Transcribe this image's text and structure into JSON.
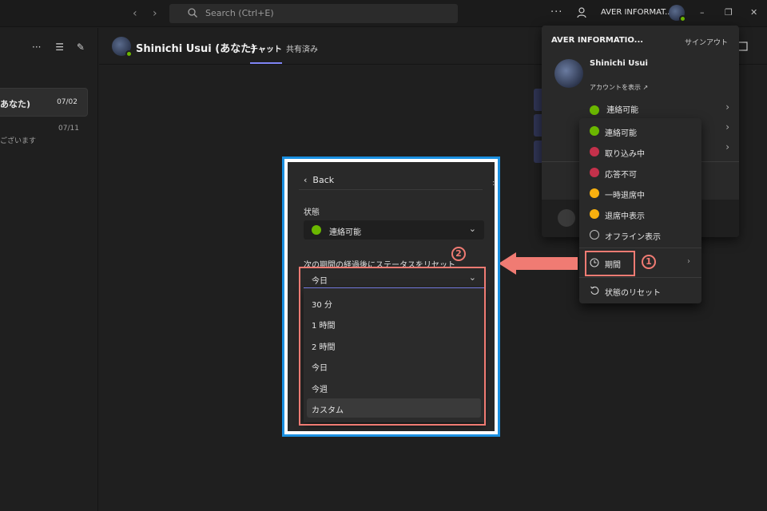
{
  "titlebar": {
    "search_placeholder": "Search (Ctrl+E)",
    "org_name": "AVER INFORMAT..."
  },
  "chat_list": {
    "selected_item": {
      "name": "あなた)",
      "date": "07/02"
    },
    "item2": {
      "date": "07/11",
      "preview": "ございます"
    }
  },
  "header": {
    "name": "Shinichi Usui (あなた)",
    "tabs": [
      "チャット",
      "共有済み"
    ]
  },
  "account_menu": {
    "org": "AVER INFORMATIO...",
    "signout": "サインアウト",
    "user_name": "Shinichi Usui",
    "view_account": "アカウントを表示",
    "status": "連絡可能"
  },
  "status_menu": {
    "items": [
      {
        "label": "連絡可能",
        "icon": "available-icon",
        "color": "#6bb700"
      },
      {
        "label": "取り込み中",
        "icon": "busy-icon",
        "color": "#c4314b"
      },
      {
        "label": "応答不可",
        "icon": "do-not-disturb-icon",
        "color": "#c4314b"
      },
      {
        "label": "一時退席中",
        "icon": "be-right-back-icon",
        "color": "#f8b00f"
      },
      {
        "label": "退席中表示",
        "icon": "away-icon",
        "color": "#f8b00f"
      },
      {
        "label": "オフライン表示",
        "icon": "offline-icon",
        "color": "#bdbdbd"
      }
    ],
    "duration": "期間",
    "reset": "状態のリセット"
  },
  "annotations": {
    "badge1": "1",
    "badge2": "2",
    "highlight_color": "#f07b73",
    "frame_color": "#1a8fe0"
  },
  "duration_panel": {
    "back": "Back",
    "status_label": "状態",
    "status_value": "連絡可能",
    "reset_label": "次の期間の経過後にステータスをリセット",
    "selected": "今日",
    "options": [
      "30 分",
      "1 時間",
      "2 時間",
      "今日",
      "今週",
      "カスタム"
    ]
  }
}
